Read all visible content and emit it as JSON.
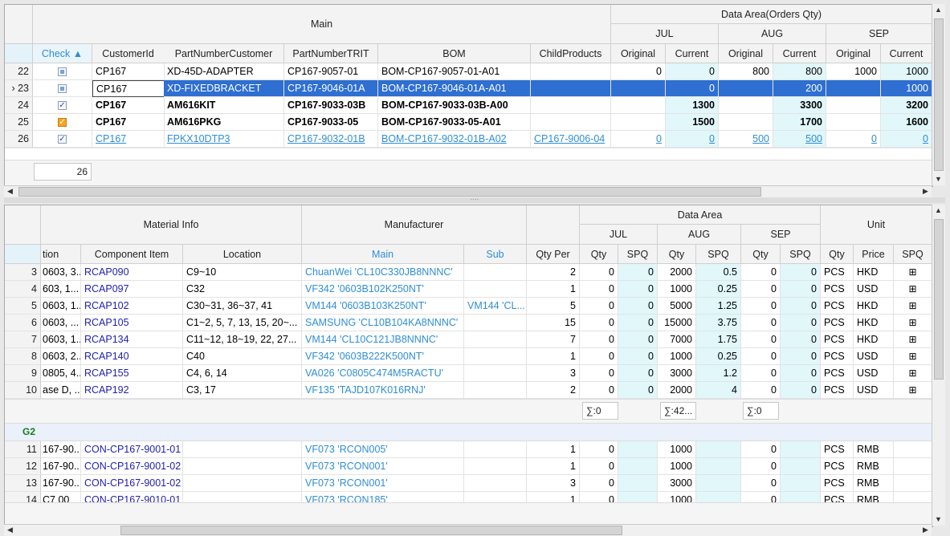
{
  "top": {
    "group_main": "Main",
    "group_data_area": "Data Area(Orders Qty)",
    "months": [
      "JUL",
      "AUG",
      "SEP"
    ],
    "sub_original": "Original",
    "sub_current": "Current",
    "columns": [
      "Check ▲",
      "CustomerId",
      "PartNumberCustomer",
      "PartNumberTRIT",
      "BOM",
      "ChildProducts"
    ],
    "rows": [
      {
        "n": "22",
        "check": "partial",
        "cust": "CP167",
        "pnc": "XD-45D-ADAPTER",
        "pnt": "CP167-9057-01",
        "bom": "BOM-CP167-9057-01-A01",
        "child": "",
        "v": [
          "0",
          "0",
          "800",
          "800",
          "1000",
          "1000"
        ],
        "style": "normal"
      },
      {
        "n": "23",
        "check": "partial",
        "cust": "CP167",
        "pnc": "XD-FIXEDBRACKET",
        "pnt": "CP167-9046-01A",
        "bom": "BOM-CP167-9046-01A-A01",
        "child": "",
        "v": [
          "",
          "0",
          "",
          "200",
          "",
          "1000"
        ],
        "style": "selected"
      },
      {
        "n": "24",
        "check": "checked",
        "cust": "CP167",
        "pnc": "AM616KIT",
        "pnt": "CP167-9033-03B",
        "bom": "BOM-CP167-9033-03B-A00",
        "child": "",
        "v": [
          "",
          "1300",
          "",
          "3300",
          "",
          "3200"
        ],
        "style": "bold"
      },
      {
        "n": "25",
        "check": "orange",
        "cust": "CP167",
        "pnc": "AM616PKG",
        "pnt": "CP167-9033-05",
        "bom": "BOM-CP167-9033-05-A01",
        "child": "",
        "v": [
          "",
          "1500",
          "",
          "1700",
          "",
          "1600"
        ],
        "style": "bold"
      },
      {
        "n": "26",
        "check": "checked",
        "cust": "CP167",
        "pnc": "FPKX10DTP3",
        "pnt": "CP167-9032-01B",
        "bom": "BOM-CP167-9032-01B-A02",
        "child": "CP167-9006-04",
        "v": [
          "0",
          "0",
          "500",
          "500",
          "0",
          "0"
        ],
        "style": "link"
      }
    ],
    "row_count": "26"
  },
  "bottom": {
    "group_material": "Material Info",
    "group_manufacturer": "Manufacturer",
    "group_data_area": "Data Area",
    "group_unit": "Unit",
    "months": [
      "JUL",
      "AUG",
      "SEP"
    ],
    "columns": [
      "tion",
      "Component Item",
      "Location",
      "Main",
      "Sub",
      "Qty Per",
      "Qty",
      "SPQ",
      "Qty",
      "SPQ",
      "Qty",
      "SPQ",
      "Qty",
      "Price",
      "SPQ"
    ],
    "rows": [
      {
        "n": "3",
        "desc": "0603, 3...",
        "item": "RCAP090",
        "loc": "C9~10",
        "main": "ChuanWei 'CL10C330JB8NNNC'",
        "sub": "",
        "qp": "2",
        "d": [
          "0",
          "0",
          "2000",
          "0.5",
          "0",
          "0"
        ],
        "uq": "PCS",
        "price": "HKD",
        "spq": true
      },
      {
        "n": "4",
        "desc": "603, 1...",
        "item": "RCAP097",
        "loc": "C32",
        "main": "VF342 '0603B102K250NT'",
        "sub": "",
        "qp": "1",
        "d": [
          "0",
          "0",
          "1000",
          "0.25",
          "0",
          "0"
        ],
        "uq": "PCS",
        "price": "USD",
        "spq": true
      },
      {
        "n": "5",
        "desc": "0603, 1...",
        "item": "RCAP102",
        "loc": " C30~31, 36~37, 41",
        "main": "VM144 '0603B103K250NT'",
        "sub": "VM144 'CL...",
        "qp": "5",
        "d": [
          "0",
          "0",
          "5000",
          "1.25",
          "0",
          "0"
        ],
        "uq": "PCS",
        "price": "HKD",
        "spq": true
      },
      {
        "n": "6",
        "desc": "0603, ...",
        "item": "RCAP105",
        "loc": "C1~2, 5, 7, 13, 15, 20~...",
        "main": "SAMSUNG 'CL10B104KA8NNNC'",
        "sub": "",
        "qp": "15",
        "d": [
          "0",
          "0",
          "15000",
          "3.75",
          "0",
          "0"
        ],
        "uq": "PCS",
        "price": "HKD",
        "spq": true
      },
      {
        "n": "7",
        "desc": "0603, 1...",
        "item": "RCAP134",
        "loc": "C11~12, 18~19, 22, 27...",
        "main": "VM144 'CL10C121JB8NNNC'",
        "sub": "",
        "qp": "7",
        "d": [
          "0",
          "0",
          "7000",
          "1.75",
          "0",
          "0"
        ],
        "uq": "PCS",
        "price": "HKD",
        "spq": true
      },
      {
        "n": "8",
        "desc": "0603, 2...",
        "item": "RCAP140",
        "loc": "C40",
        "main": "VF342 '0603B222K500NT'",
        "sub": "",
        "qp": "1",
        "d": [
          "0",
          "0",
          "1000",
          "0.25",
          "0",
          "0"
        ],
        "uq": "PCS",
        "price": "USD",
        "spq": true
      },
      {
        "n": "9",
        "desc": "0805, 4...",
        "item": "RCAP155",
        "loc": "C4, 6, 14",
        "main": "VA026 'C0805C474M5RACTU'",
        "sub": "",
        "qp": "3",
        "d": [
          "0",
          "0",
          "3000",
          "1.2",
          "0",
          "0"
        ],
        "uq": "PCS",
        "price": "USD",
        "spq": true
      },
      {
        "n": "10",
        "desc": "ase D, ...",
        "item": "RCAP192",
        "loc": "C3, 17",
        "main": "VF135 'TAJD107K016RNJ'",
        "sub": "",
        "qp": "2",
        "d": [
          "0",
          "0",
          "2000",
          "4",
          "0",
          "0"
        ],
        "uq": "PCS",
        "price": "USD",
        "spq": true
      }
    ],
    "sums": [
      "∑:0",
      "∑:42...",
      "∑:0"
    ],
    "group2_label": "G2",
    "rows2": [
      {
        "n": "11",
        "desc": "167-90...",
        "item": "CON-CP167-9001-01",
        "loc": "",
        "main": "VF073 'RCON005'",
        "sub": "",
        "qp": "1",
        "d": [
          "0",
          "",
          "1000",
          "",
          "0",
          ""
        ],
        "uq": "PCS",
        "price": "RMB"
      },
      {
        "n": "12",
        "desc": "167-90...",
        "item": "CON-CP167-9001-02",
        "loc": "",
        "main": "VF073 'RCON001'",
        "sub": "",
        "qp": "1",
        "d": [
          "0",
          "",
          "1000",
          "",
          "0",
          ""
        ],
        "uq": "PCS",
        "price": "RMB"
      },
      {
        "n": "13",
        "desc": "167-90...",
        "item": "CON-CP167-9001-02",
        "loc": "",
        "main": "VF073 'RCON001'",
        "sub": "",
        "qp": "3",
        "d": [
          "0",
          "",
          "3000",
          "",
          "0",
          ""
        ],
        "uq": "PCS",
        "price": "RMB"
      },
      {
        "n": "14",
        "desc": "C7 00",
        "item": "CON-CP167-9010-01",
        "loc": "",
        "main": "VF073 'RCON185'",
        "sub": "",
        "qp": "1",
        "d": [
          "0",
          "",
          "1000",
          "",
          "0",
          ""
        ],
        "uq": "PCS",
        "price": "RMB"
      }
    ]
  }
}
